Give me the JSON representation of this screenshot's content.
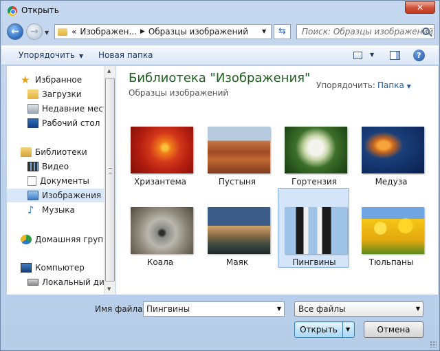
{
  "window": {
    "title": "Открыть",
    "close_glyph": "✕"
  },
  "nav": {
    "back_glyph": "←",
    "forward_glyph": "→",
    "breadcrumb": [
      "«",
      "Изображен...",
      "Образцы изображений"
    ],
    "search_placeholder": "Поиск: Образцы изображений",
    "refresh_glyph": "⇆"
  },
  "toolbar": {
    "organize": "Упорядочить",
    "new_folder": "Новая папка",
    "help": "?"
  },
  "sidebar": {
    "items": [
      {
        "label": "Избранное",
        "icon": "star-icon"
      },
      {
        "label": "Загрузки",
        "icon": "downloads-icon"
      },
      {
        "label": "Недавние места",
        "icon": "recent-places-icon"
      },
      {
        "label": "Рабочий стол",
        "icon": "desktop-icon"
      },
      {
        "label": "Библиотеки",
        "icon": "libraries-icon"
      },
      {
        "label": "Видео",
        "icon": "video-icon"
      },
      {
        "label": "Документы",
        "icon": "documents-icon"
      },
      {
        "label": "Изображения",
        "icon": "pictures-icon"
      },
      {
        "label": "Музыка",
        "icon": "music-icon"
      },
      {
        "label": "Домашняя группа",
        "icon": "homegroup-icon"
      },
      {
        "label": "Компьютер",
        "icon": "computer-icon"
      },
      {
        "label": "Локальный диск",
        "icon": "drive-icon"
      }
    ]
  },
  "main": {
    "library_title": "Библиотека \"Изображения\"",
    "library_subtitle": "Образцы изображений",
    "arrange_label": "Упорядочить:",
    "arrange_value": "Папка",
    "items": [
      {
        "label": "Хризантема",
        "icon": "chrysanthemum-thumbnail"
      },
      {
        "label": "Пустыня",
        "icon": "desert-thumbnail"
      },
      {
        "label": "Гортензия",
        "icon": "hydrangeas-thumbnail"
      },
      {
        "label": "Медуза",
        "icon": "jellyfish-thumbnail"
      },
      {
        "label": "Коала",
        "icon": "koala-thumbnail"
      },
      {
        "label": "Маяк",
        "icon": "lighthouse-thumbnail"
      },
      {
        "label": "Пингвины",
        "icon": "penguins-thumbnail"
      },
      {
        "label": "Тюльпаны",
        "icon": "tulips-thumbnail"
      }
    ],
    "selected_item": "Пингвины"
  },
  "footer": {
    "filename_label": "Имя файла:",
    "filename_value": "Пингвины",
    "filter_value": "Все файлы",
    "open_label": "Открыть",
    "cancel_label": "Отмена"
  }
}
